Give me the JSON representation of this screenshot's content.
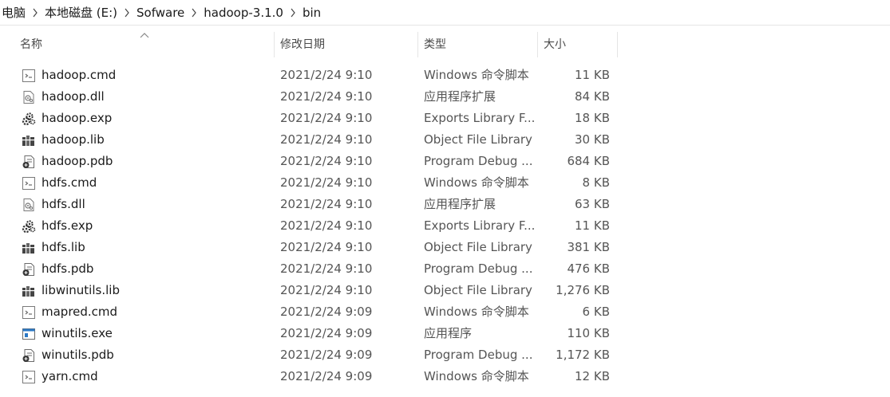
{
  "breadcrumb": [
    "电脑",
    "本地磁盘 (E:)",
    "Sofware",
    "hadoop-3.1.0",
    "bin"
  ],
  "columns": {
    "name": "名称",
    "date": "修改日期",
    "type": "类型",
    "size": "大小"
  },
  "files": [
    {
      "name": "hadoop.cmd",
      "date": "2021/2/24 9:10",
      "type": "Windows 命令脚本",
      "size": "11 KB",
      "icon": "cmd-file-icon"
    },
    {
      "name": "hadoop.dll",
      "date": "2021/2/24 9:10",
      "type": "应用程序扩展",
      "size": "84 KB",
      "icon": "dll-file-icon"
    },
    {
      "name": "hadoop.exp",
      "date": "2021/2/24 9:10",
      "type": "Exports Library F...",
      "size": "18 KB",
      "icon": "exp-file-icon"
    },
    {
      "name": "hadoop.lib",
      "date": "2021/2/24 9:10",
      "type": "Object File Library",
      "size": "30 KB",
      "icon": "lib-file-icon"
    },
    {
      "name": "hadoop.pdb",
      "date": "2021/2/24 9:10",
      "type": "Program Debug ...",
      "size": "684 KB",
      "icon": "pdb-file-icon"
    },
    {
      "name": "hdfs.cmd",
      "date": "2021/2/24 9:10",
      "type": "Windows 命令脚本",
      "size": "8 KB",
      "icon": "cmd-file-icon"
    },
    {
      "name": "hdfs.dll",
      "date": "2021/2/24 9:10",
      "type": "应用程序扩展",
      "size": "63 KB",
      "icon": "dll-file-icon"
    },
    {
      "name": "hdfs.exp",
      "date": "2021/2/24 9:10",
      "type": "Exports Library F...",
      "size": "11 KB",
      "icon": "exp-file-icon"
    },
    {
      "name": "hdfs.lib",
      "date": "2021/2/24 9:10",
      "type": "Object File Library",
      "size": "381 KB",
      "icon": "lib-file-icon"
    },
    {
      "name": "hdfs.pdb",
      "date": "2021/2/24 9:10",
      "type": "Program Debug ...",
      "size": "476 KB",
      "icon": "pdb-file-icon"
    },
    {
      "name": "libwinutils.lib",
      "date": "2021/2/24 9:10",
      "type": "Object File Library",
      "size": "1,276 KB",
      "icon": "lib-file-icon"
    },
    {
      "name": "mapred.cmd",
      "date": "2021/2/24 9:09",
      "type": "Windows 命令脚本",
      "size": "6 KB",
      "icon": "cmd-file-icon"
    },
    {
      "name": "winutils.exe",
      "date": "2021/2/24 9:09",
      "type": "应用程序",
      "size": "110 KB",
      "icon": "exe-file-icon"
    },
    {
      "name": "winutils.pdb",
      "date": "2021/2/24 9:09",
      "type": "Program Debug ...",
      "size": "1,172 KB",
      "icon": "pdb-file-icon"
    },
    {
      "name": "yarn.cmd",
      "date": "2021/2/24 9:09",
      "type": "Windows 命令脚本",
      "size": "12 KB",
      "icon": "cmd-file-icon"
    }
  ]
}
